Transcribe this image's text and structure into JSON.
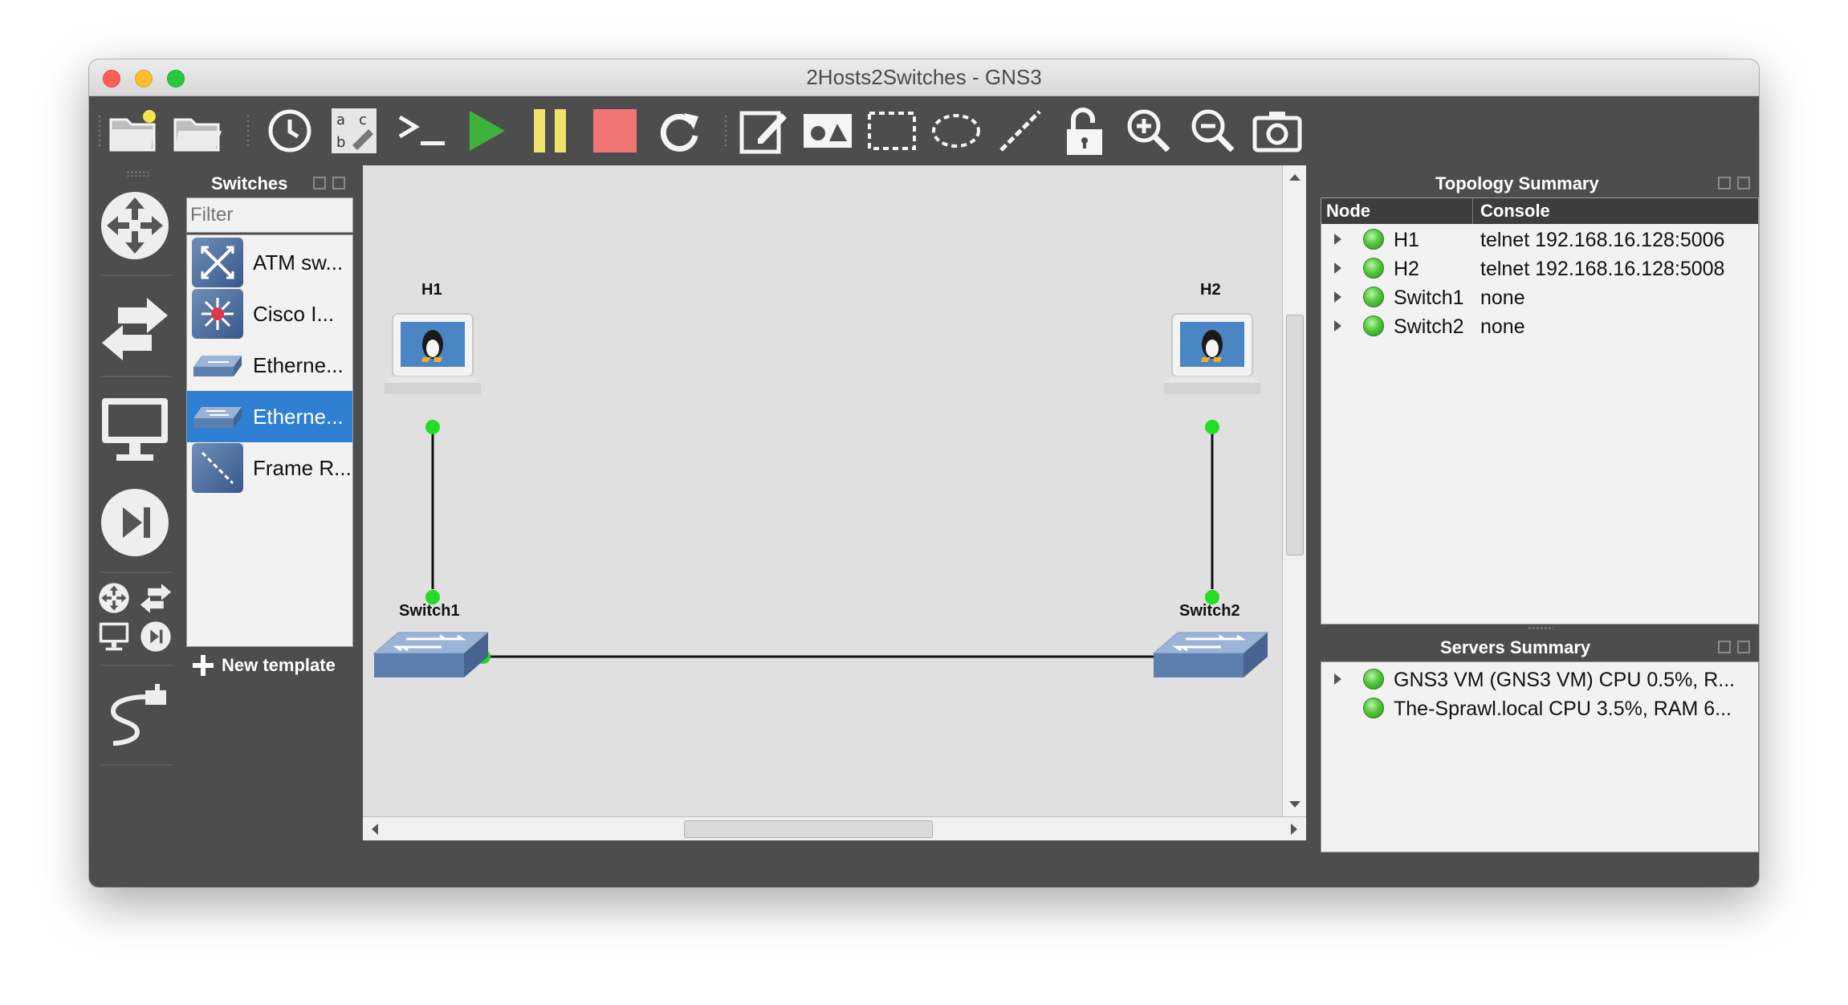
{
  "window": {
    "title": "2Hosts2Switches - GNS3"
  },
  "toolbar": {
    "icons": [
      "new-project-icon",
      "open-project-icon",
      "snapshot-clock-icon",
      "show-interface-labels-icon",
      "console-all-icon",
      "start-all-icon",
      "suspend-all-icon",
      "stop-all-icon",
      "reload-all-icon",
      "add-note-icon",
      "insert-picture-icon",
      "draw-rectangle-icon",
      "draw-ellipse-icon",
      "draw-line-icon",
      "lock-unlock-icon",
      "zoom-in-icon",
      "zoom-out-icon",
      "screenshot-icon"
    ],
    "colors": {
      "start": "#3db23d",
      "pause": "#f0e36c",
      "stop": "#f07575"
    }
  },
  "switches_panel": {
    "title": "Switches",
    "filter_placeholder": "Filter",
    "items": [
      {
        "label": "ATM sw...",
        "icon": "atm-switch-icon"
      },
      {
        "label": "Cisco I...",
        "icon": "cisco-iou-switch-icon"
      },
      {
        "label": "Etherne...",
        "icon": "ethernet-hub-icon"
      },
      {
        "label": "Etherne...",
        "icon": "ethernet-switch-icon"
      },
      {
        "label": "Frame R...",
        "icon": "frame-relay-switch-icon"
      }
    ],
    "selected_index": 3,
    "new_template_label": "New template"
  },
  "topology": {
    "nodes": [
      {
        "name": "H1",
        "type": "host"
      },
      {
        "name": "H2",
        "type": "host"
      },
      {
        "name": "Switch1",
        "type": "switch"
      },
      {
        "name": "Switch2",
        "type": "switch"
      }
    ],
    "link_status_color": "#22dd22"
  },
  "topology_summary": {
    "title": "Topology Summary",
    "columns": [
      "Node",
      "Console"
    ],
    "rows": [
      {
        "node": "H1",
        "console": "telnet 192.168.16.128:5006"
      },
      {
        "node": "H2",
        "console": "telnet 192.168.16.128:5008"
      },
      {
        "node": "Switch1",
        "console": "none"
      },
      {
        "node": "Switch2",
        "console": "none"
      }
    ]
  },
  "servers_summary": {
    "title": "Servers Summary",
    "rows": [
      {
        "text": "GNS3 VM (GNS3 VM) CPU 0.5%, R..."
      },
      {
        "text": "The-Sprawl.local CPU 3.5%, RAM 6..."
      }
    ]
  }
}
